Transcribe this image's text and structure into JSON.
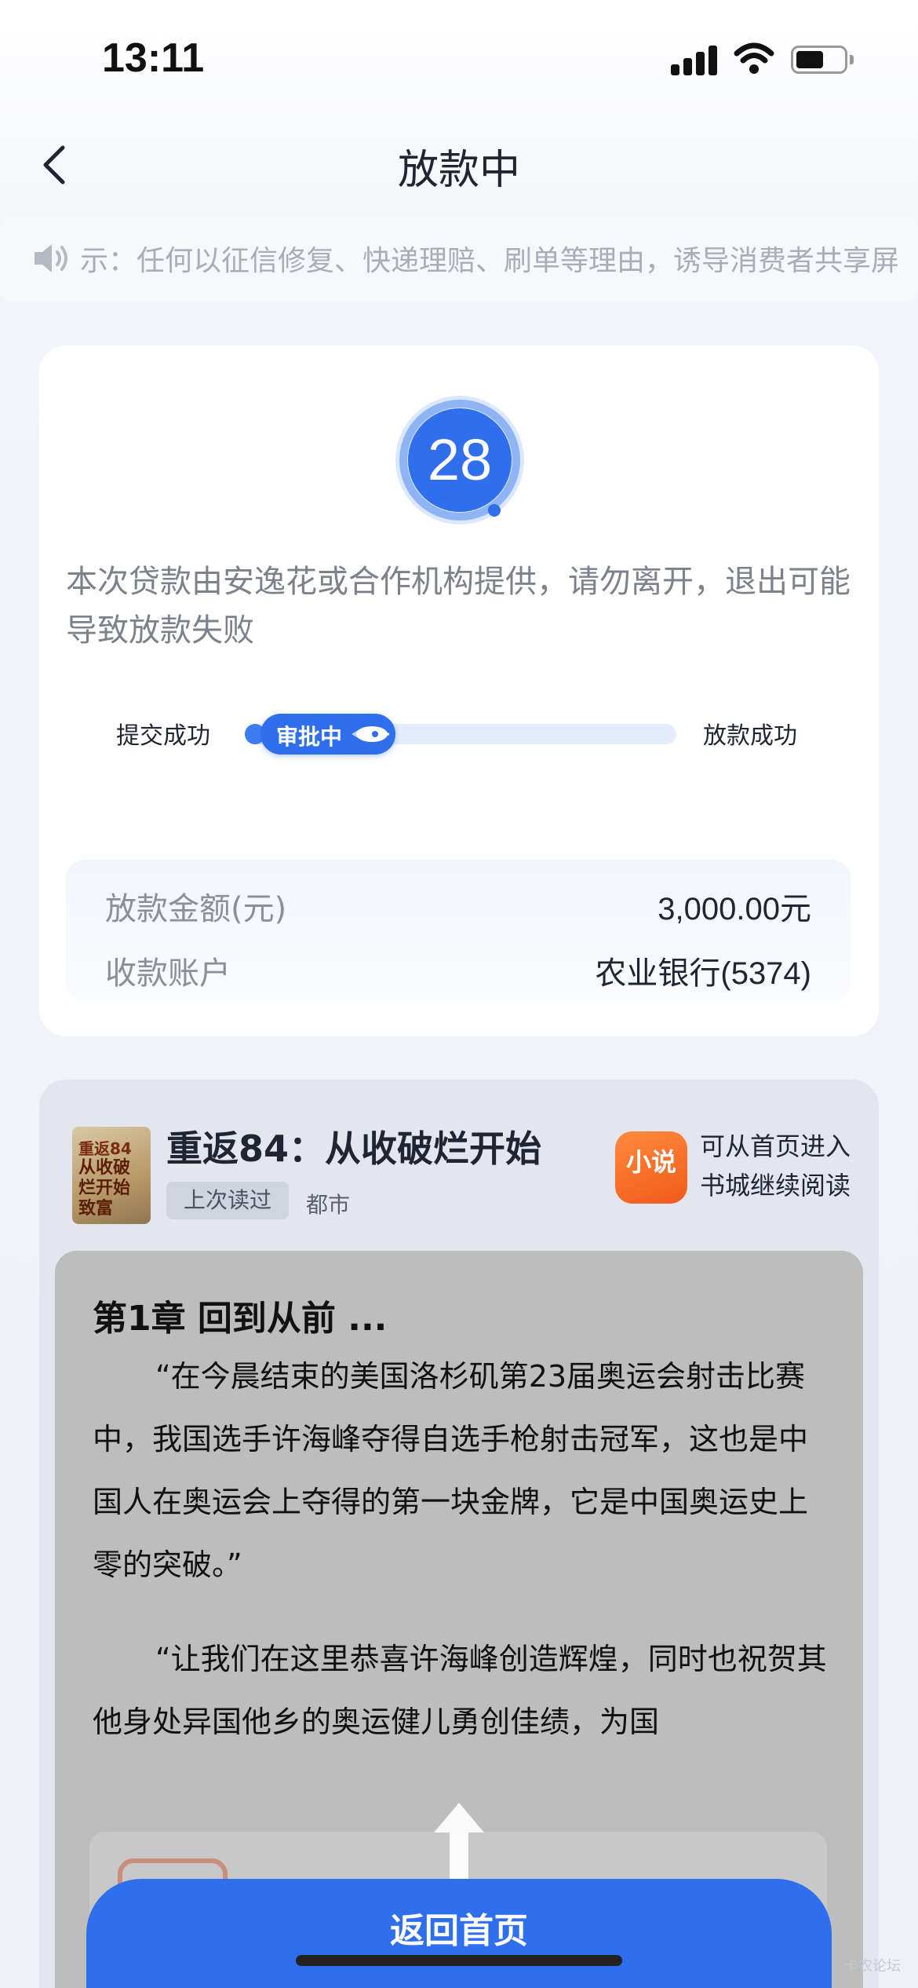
{
  "status_bar": {
    "time": "13:11"
  },
  "nav": {
    "title": "放款中"
  },
  "notice": {
    "text": "示：任何以征信修复、快递理赔、刷单等理由，诱导消费者共享屏"
  },
  "loan_card": {
    "countdown": "28",
    "message": "本次贷款由安逸花或合作机构提供，请勿离开，退出可能导致放款失败",
    "progress": {
      "step_start": "提交成功",
      "current_stage": "审批中",
      "step_end": "放款成功"
    },
    "details": [
      {
        "label": "放款金额(元)",
        "value": "3,000.00元"
      },
      {
        "label": "收款账户",
        "value": "农业银行(5374)"
      }
    ]
  },
  "novel": {
    "cover_line1": "重返84",
    "cover_line2": "从收破烂开始致富",
    "title": "重返84：从收破烂开始",
    "tag_last_read": "上次读过",
    "genre": "都市",
    "app_icon_text": "小说",
    "app_hint": "可从首页进入书城继续阅读",
    "chapter_title": "第1章 回到从前 ...",
    "paragraph1": "“在今晨结束的美国洛杉矶第23届奥运会射击比赛中，我国选手许海峰夺得自选手枪射击冠军，这也是中国人在奥运会上夺得的第一块金牌，它是中国奥运史上零的突破。”",
    "paragraph2": "“让我们在这里恭喜许海峰创造辉煌，同时也祝贺其他身处异国他乡的奥运健儿勇创佳绩，为国"
  },
  "footer": {
    "home_button": "返回首页",
    "watermark": "卡农论坛"
  },
  "colors": {
    "accent": "#2f6fec",
    "app_icon": "#f05a1a"
  },
  "icons": [
    "back-icon",
    "speaker-icon",
    "signal-icon",
    "wifi-icon",
    "battery-icon",
    "rocket-icon",
    "swipe-up-icon"
  ]
}
